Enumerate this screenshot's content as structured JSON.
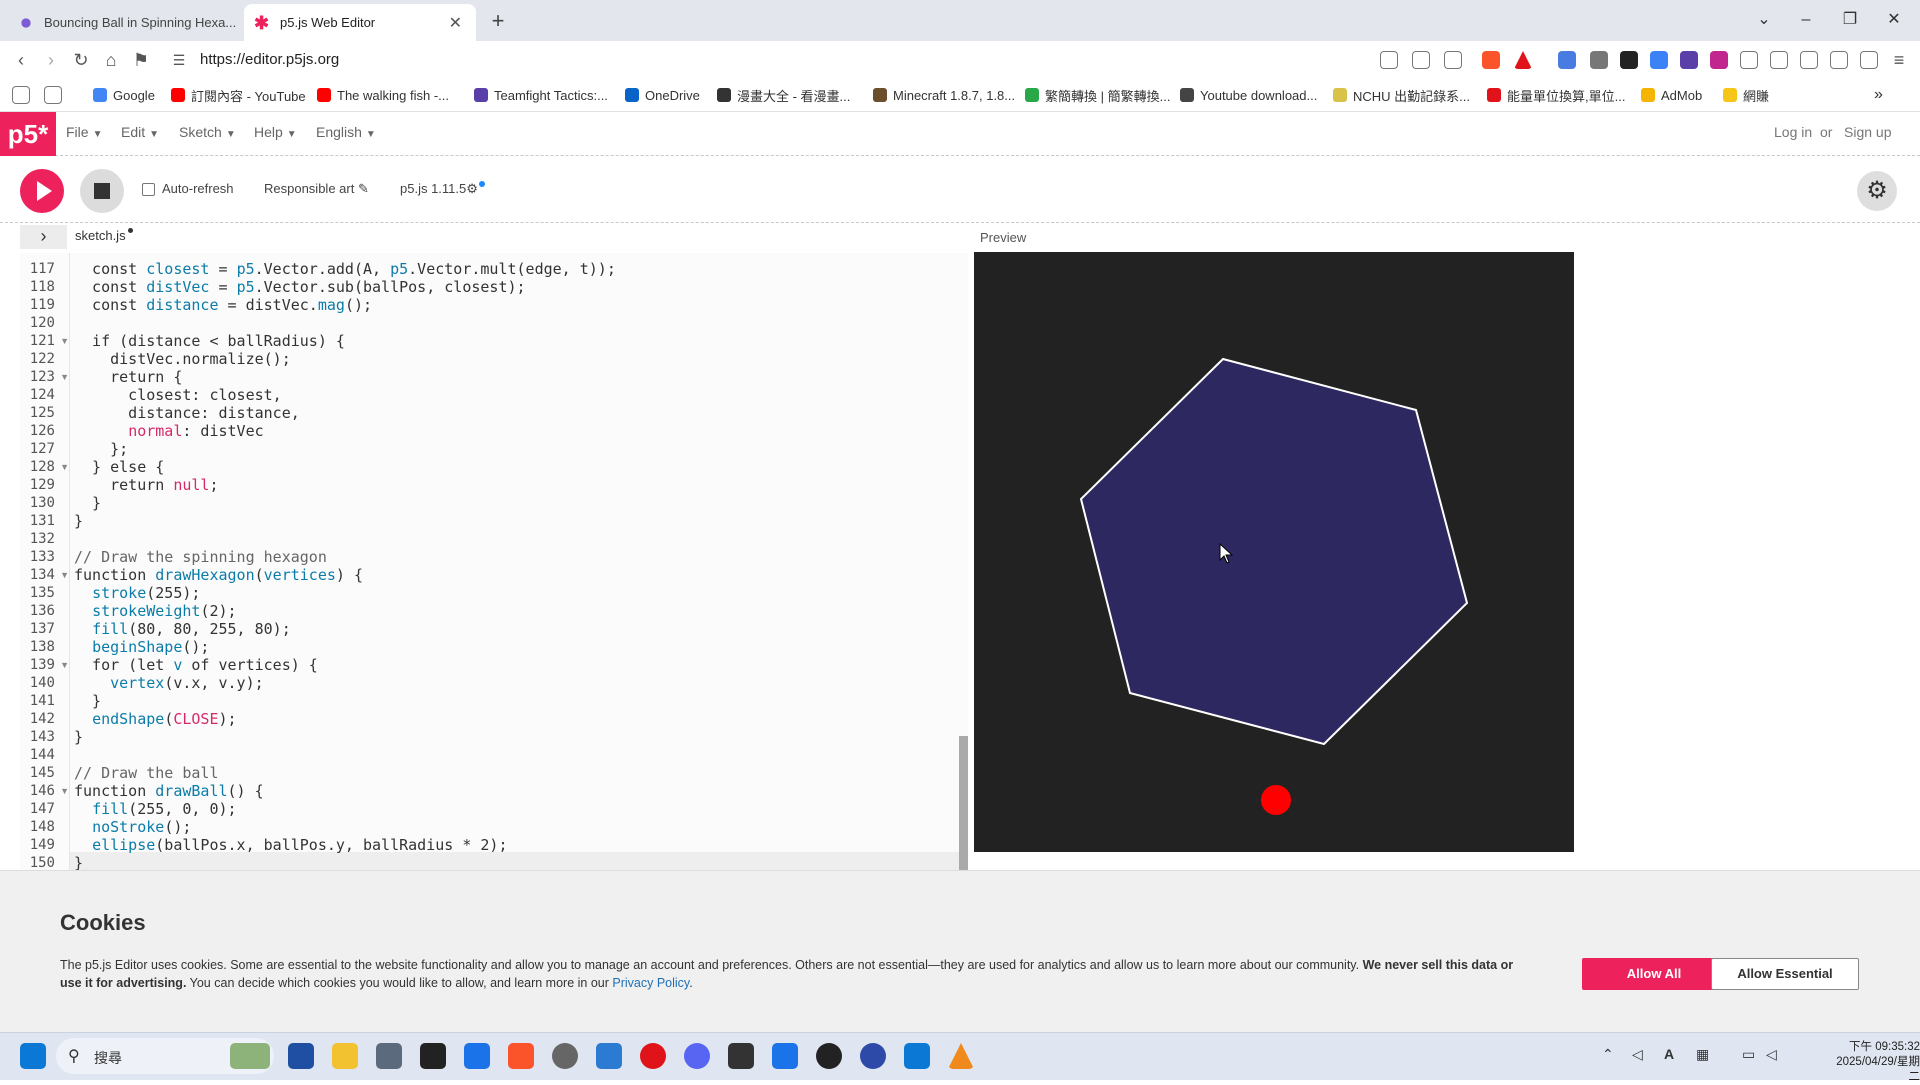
{
  "browser": {
    "tabs": [
      {
        "title": "Bouncing Ball in Spinning Hexa...",
        "active": false,
        "icon": "claude-icon"
      },
      {
        "title": "p5.js Web Editor",
        "active": true,
        "icon": "p5-asterisk-icon"
      }
    ],
    "url": "https://editor.p5js.org",
    "bookmarks": [
      {
        "label": "Google",
        "color": "#4285f4"
      },
      {
        "label": "訂閱內容 - YouTube",
        "color": "#ff0000"
      },
      {
        "label": "The walking fish -...",
        "color": "#ff0000"
      },
      {
        "label": "Teamfight Tactics:...",
        "color": "#5b3fa8"
      },
      {
        "label": "OneDrive",
        "color": "#0a64c8"
      },
      {
        "label": "漫畫大全 - 看漫畫...",
        "color": "#333333"
      },
      {
        "label": "Minecraft 1.8.7, 1.8...",
        "color": "#6b4e2c"
      },
      {
        "label": "繁簡轉換 | 簡繁轉換...",
        "color": "#29a84a"
      },
      {
        "label": "Youtube download...",
        "color": "#444444"
      },
      {
        "label": "NCHU 出勤記錄系...",
        "color": "#d8c24a"
      },
      {
        "label": "能量單位換算,單位...",
        "color": "#e1131a"
      },
      {
        "label": "AdMob",
        "color": "#f4b400"
      },
      {
        "label": "網賺",
        "color": "#f5c518"
      }
    ]
  },
  "p5": {
    "logo": "p5*",
    "menu": [
      "File",
      "Edit",
      "Sketch",
      "Help",
      "English"
    ],
    "login": "Log in",
    "or": "or",
    "signup": "Sign up",
    "auto_refresh": "Auto-refresh",
    "responsible_art": "Responsible art",
    "version": "p5.js 1.11.5",
    "file_tab": "sketch.js",
    "preview_label": "Preview"
  },
  "code": {
    "lines": [
      {
        "n": "117",
        "fold": false,
        "tokens": [
          [
            "pl",
            "  const "
          ],
          [
            "tok-f",
            "closest"
          ],
          [
            "pl",
            " = "
          ],
          [
            "tok-p5",
            "p5"
          ],
          [
            "pl",
            ".Vector.add(A, "
          ],
          [
            "tok-p5",
            "p5"
          ],
          [
            "pl",
            ".Vector.mult(edge, t));"
          ]
        ]
      },
      {
        "n": "118",
        "fold": false,
        "tokens": [
          [
            "pl",
            "  const "
          ],
          [
            "tok-f",
            "distVec"
          ],
          [
            "pl",
            " = "
          ],
          [
            "tok-p5",
            "p5"
          ],
          [
            "pl",
            ".Vector.sub(ballPos, closest);"
          ]
        ]
      },
      {
        "n": "119",
        "fold": false,
        "tokens": [
          [
            "pl",
            "  const "
          ],
          [
            "tok-f",
            "distance"
          ],
          [
            "pl",
            " = distVec."
          ],
          [
            "tok-f",
            "mag"
          ],
          [
            "pl",
            "();"
          ]
        ]
      },
      {
        "n": "120",
        "fold": false,
        "tokens": [
          [
            "pl",
            ""
          ]
        ]
      },
      {
        "n": "121",
        "fold": true,
        "tokens": [
          [
            "pl",
            "  if (distance < ballRadius) {"
          ]
        ]
      },
      {
        "n": "122",
        "fold": false,
        "tokens": [
          [
            "pl",
            "    distVec.normalize();"
          ]
        ]
      },
      {
        "n": "123",
        "fold": true,
        "tokens": [
          [
            "pl",
            "    return {"
          ]
        ]
      },
      {
        "n": "124",
        "fold": false,
        "tokens": [
          [
            "pl",
            "      closest: closest,"
          ]
        ]
      },
      {
        "n": "125",
        "fold": false,
        "tokens": [
          [
            "pl",
            "      distance: distance,"
          ]
        ]
      },
      {
        "n": "126",
        "fold": false,
        "tokens": [
          [
            "pl",
            "      "
          ],
          [
            "tok-s",
            "normal"
          ],
          [
            "pl",
            ": distVec"
          ]
        ]
      },
      {
        "n": "127",
        "fold": false,
        "tokens": [
          [
            "pl",
            "    };"
          ]
        ]
      },
      {
        "n": "128",
        "fold": true,
        "tokens": [
          [
            "pl",
            "  } else {"
          ]
        ]
      },
      {
        "n": "129",
        "fold": false,
        "tokens": [
          [
            "pl",
            "    return "
          ],
          [
            "tok-s",
            "null"
          ],
          [
            "pl",
            ";"
          ]
        ]
      },
      {
        "n": "130",
        "fold": false,
        "tokens": [
          [
            "pl",
            "  }"
          ]
        ]
      },
      {
        "n": "131",
        "fold": false,
        "tokens": [
          [
            "pl",
            "}"
          ]
        ]
      },
      {
        "n": "132",
        "fold": false,
        "tokens": [
          [
            "pl",
            ""
          ]
        ]
      },
      {
        "n": "133",
        "fold": false,
        "tokens": [
          [
            "tok-c",
            "// Draw the spinning hexagon"
          ]
        ]
      },
      {
        "n": "134",
        "fold": true,
        "tokens": [
          [
            "pl",
            "function "
          ],
          [
            "tok-f",
            "drawHexagon"
          ],
          [
            "pl",
            "("
          ],
          [
            "tok-f",
            "vertices"
          ],
          [
            "pl",
            ") {"
          ]
        ]
      },
      {
        "n": "135",
        "fold": false,
        "tokens": [
          [
            "pl",
            "  "
          ],
          [
            "tok-fb",
            "stroke"
          ],
          [
            "pl",
            "(255);"
          ]
        ]
      },
      {
        "n": "136",
        "fold": false,
        "tokens": [
          [
            "pl",
            "  "
          ],
          [
            "tok-fb",
            "strokeWeight"
          ],
          [
            "pl",
            "(2);"
          ]
        ]
      },
      {
        "n": "137",
        "fold": false,
        "tokens": [
          [
            "pl",
            "  "
          ],
          [
            "tok-fb",
            "fill"
          ],
          [
            "pl",
            "(80, 80, 255, 80);"
          ]
        ]
      },
      {
        "n": "138",
        "fold": false,
        "tokens": [
          [
            "pl",
            "  "
          ],
          [
            "tok-fb",
            "beginShape"
          ],
          [
            "pl",
            "();"
          ]
        ]
      },
      {
        "n": "139",
        "fold": true,
        "tokens": [
          [
            "pl",
            "  for (let "
          ],
          [
            "tok-f",
            "v"
          ],
          [
            "pl",
            " of vertices) {"
          ]
        ]
      },
      {
        "n": "140",
        "fold": false,
        "tokens": [
          [
            "pl",
            "    "
          ],
          [
            "tok-fb",
            "vertex"
          ],
          [
            "pl",
            "(v.x, v.y);"
          ]
        ]
      },
      {
        "n": "141",
        "fold": false,
        "tokens": [
          [
            "pl",
            "  }"
          ]
        ]
      },
      {
        "n": "142",
        "fold": false,
        "tokens": [
          [
            "pl",
            "  "
          ],
          [
            "tok-fb",
            "endShape"
          ],
          [
            "pl",
            "("
          ],
          [
            "tok-s",
            "CLOSE"
          ],
          [
            "pl",
            ");"
          ]
        ]
      },
      {
        "n": "143",
        "fold": false,
        "tokens": [
          [
            "pl",
            "}"
          ]
        ]
      },
      {
        "n": "144",
        "fold": false,
        "tokens": [
          [
            "pl",
            ""
          ]
        ]
      },
      {
        "n": "145",
        "fold": false,
        "tokens": [
          [
            "tok-c",
            "// Draw the ball"
          ]
        ]
      },
      {
        "n": "146",
        "fold": true,
        "tokens": [
          [
            "pl",
            "function "
          ],
          [
            "tok-f",
            "drawBall"
          ],
          [
            "pl",
            "() {"
          ]
        ]
      },
      {
        "n": "147",
        "fold": false,
        "tokens": [
          [
            "pl",
            "  "
          ],
          [
            "tok-fb",
            "fill"
          ],
          [
            "pl",
            "(255, 0, 0);"
          ]
        ]
      },
      {
        "n": "148",
        "fold": false,
        "tokens": [
          [
            "pl",
            "  "
          ],
          [
            "tok-fb",
            "noStroke"
          ],
          [
            "pl",
            "();"
          ]
        ]
      },
      {
        "n": "149",
        "fold": false,
        "tokens": [
          [
            "pl",
            "  "
          ],
          [
            "tok-fb",
            "ellipse"
          ],
          [
            "pl",
            "(ballPos.x, ballPos.y, ballRadius * 2);"
          ]
        ]
      },
      {
        "n": "150",
        "fold": false,
        "tokens": [
          [
            "pl",
            "}"
          ]
        ]
      }
    ]
  },
  "cookies": {
    "title": "Cookies",
    "text_part1": "The p5.js Editor uses cookies. Some are essential to the website functionality and allow you to manage an account and preferences. Others are not essential—they are used for analytics and allow us to learn more about our community. ",
    "text_bold": "We never sell this data or use it for advertising.",
    "text_part2": " You can decide which cookies you would like to allow, and learn more in our ",
    "link": "Privacy Policy",
    "text_end": ".",
    "allow_all": "Allow All",
    "allow_essential": "Allow Essential"
  },
  "taskbar": {
    "search_placeholder": "搜尋",
    "time": "下午 09:35:32",
    "date": "2025/04/29/星期二"
  }
}
